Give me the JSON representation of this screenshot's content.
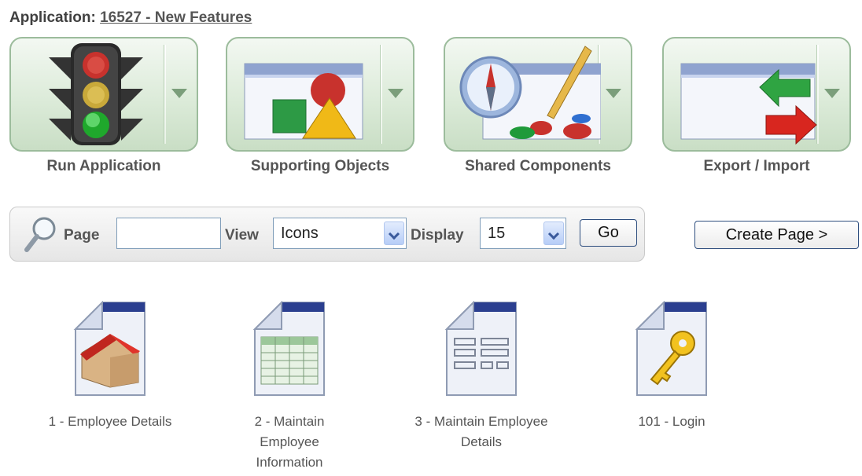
{
  "header": {
    "label": "Application:",
    "app_link": "16527 - New Features"
  },
  "tiles": [
    {
      "label": "Run Application",
      "icon": "traffic-light-icon"
    },
    {
      "label": "Supporting Objects",
      "icon": "shapes-icon"
    },
    {
      "label": "Shared Components",
      "icon": "compass-brush-icon"
    },
    {
      "label": "Export / Import",
      "icon": "export-import-arrows-icon"
    }
  ],
  "search": {
    "page_label": "Page",
    "page_value": "",
    "view_label": "View",
    "view_value": "Icons",
    "display_label": "Display",
    "display_value": "15",
    "go_label": "Go"
  },
  "create_page_label": "Create Page >",
  "pages": [
    {
      "caption": "1 - Employee Details",
      "icon": "house-page-icon"
    },
    {
      "caption": "2 - Maintain Employee Information",
      "icon": "grid-page-icon"
    },
    {
      "caption": "3 - Maintain Employee Details",
      "icon": "form-page-icon"
    },
    {
      "caption": "101 - Login",
      "icon": "key-page-icon"
    }
  ]
}
